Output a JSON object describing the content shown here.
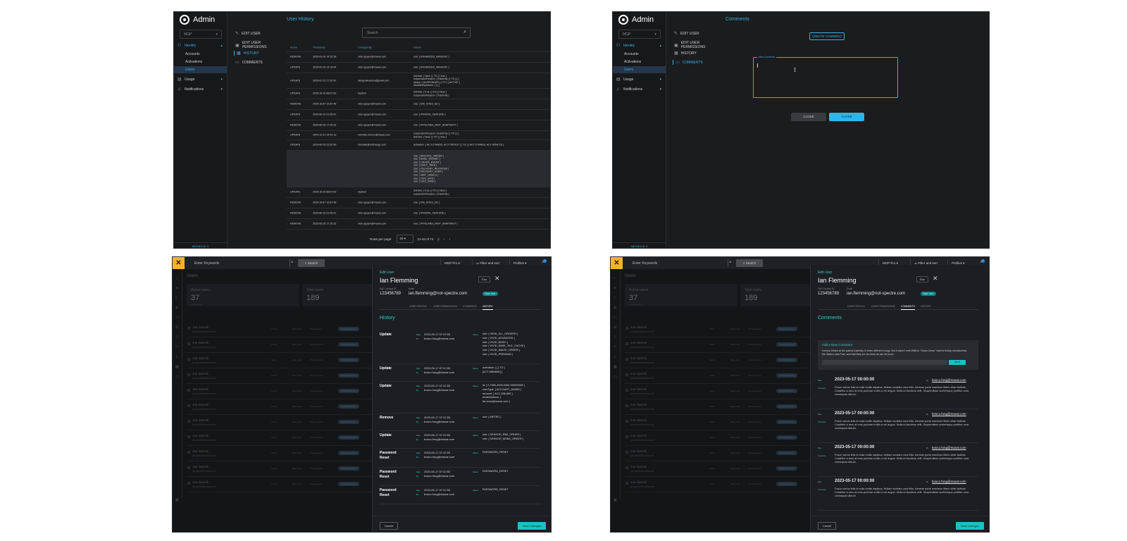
{
  "admin": {
    "brand": "Admin",
    "org_select": "MGP",
    "nav": [
      {
        "label": "Identity",
        "icon": "identity-icon"
      },
      {
        "label": "Usage",
        "icon": "usage-icon"
      },
      {
        "label": "Notifications",
        "icon": "bell-icon"
      }
    ],
    "identity_sub": [
      "Accounts",
      "Activations",
      "Users"
    ],
    "sidebar_footer": "MICHELLE 3",
    "subnav": [
      "Edit User",
      "Edit User Permissions",
      "History",
      "Comments"
    ]
  },
  "history_panel": {
    "title": "User History",
    "search_placeholder": "Search",
    "columns": [
      "Action",
      "Timestamp",
      "Changed By",
      "Values"
    ],
    "rows": [
      {
        "action": "REMOVE",
        "ts": "2026-02-24 14:31:28",
        "by": "nick.nguyen@maxar.com",
        "val": "role: [ ENHANCED_IMAGERY ]"
      },
      {
        "action": "UPDATE",
        "ts": "2026-02-24 14:16:54",
        "by": "nick.nguyen@maxar.com",
        "val": "role: [ ENHANCED_IMAGERY ]"
      },
      {
        "action": "UPDATE",
        "ts": "2026-02-23 17:32:42",
        "by": "skingmatuanbo@gmail.com",
        "val": "isActive: [ false ] [ TO ] [ true ]\nsuspensionReason: [ Inactivity ] [ TO ] [ ]\nstatus: [ SUSPENDED ] [ TO ] [ ACTIVE ]\ndisabledByAdmin: [ ] [ ]"
      },
      {
        "action": "UPDATE",
        "ts": "2025-18-16 88:87:83",
        "by": "System",
        "val": "isActive: [ true ] [ TO ] [ false ]\nsuspensionReason: [ Inactivity ]"
      },
      {
        "action": "REMOVE",
        "ts": "2025-18-87 15:87:48",
        "by": "nick.nguyen@maxar.com",
        "val": "role: [ DM_SITES_ED ]"
      },
      {
        "action": "UPDATE",
        "ts": "2025-89-15 21:59:41",
        "by": "nick.nguyen@maxar.com",
        "val": "role: [ PRIVATE_FEATURE ]"
      },
      {
        "action": "REMOVE",
        "ts": "2025-85-26 17:29:32",
        "by": "nick.nguyen@maxar.com",
        "val": "role: [ PIPELINES_MGP_SNAPSHOT ]"
      },
      {
        "action": "UPDATE",
        "ts": "2024-12-31 14:51:13",
        "by": "michelle.munoz@maxar.com",
        "val": "suspensionReason: [ Inactivity ] [ TO ] [ ]\nisActive: [ false ] [ TO ] [ true ]"
      },
      {
        "action": "UPDATE",
        "ts": "2024-89-26 22:52:89",
        "by": "michelle@michange.com",
        "val": "activation: [ ACT-2794833, ACT-7567817 ] [ TO ] [ ACT-2794833, ACT-9054718 ]"
      },
      {
        "action": "",
        "ts": "",
        "by": "",
        "val": "role: [ ARCHIVE_ORDER ]\nrole: [ BASE_MOSAIC ]\nrole: [ CROSS_EVENT ]\nrole: [ DAILY_TAKE ]\nrole: [ DELIVERY_REGISTER ]\nrole: [ DELIVERY_USER ]\nrole: [ MAP_LABELS ]\nrole: [ OGC_WFS ]\nrole: [ OGC_WMS ]"
      },
      {
        "action": "UPDATE",
        "ts": "2025-18-16 88:87:83",
        "by": "System",
        "val": "isActive: [ true ] [ TO ] [ false ]\nsuspensionReason: [ Inactivity ]"
      },
      {
        "action": "REMOVE",
        "ts": "2025-18-87 15:87:48",
        "by": "nick.nguyen@maxar.com",
        "val": "role: [ DM_SITES_ED ]"
      },
      {
        "action": "REMOVE",
        "ts": "2025-89-15 21:59:41",
        "by": "nick.nguyen@maxar.com",
        "val": "role: [ PRIVATE_FEATURE ]"
      },
      {
        "action": "REMOVE",
        "ts": "2025-85-26 17:29:32",
        "by": "nick.nguyen@maxar.com",
        "val": "role: [ PIPELINES_MGP_SNAPSHOT ]"
      }
    ],
    "pager": {
      "rows_per_page_label": "Rows per page:",
      "rows_per_page": "20",
      "range": "21-40 of 74"
    }
  },
  "comments_panel": {
    "title": "Comments",
    "create_button": "Create Comment",
    "field_label": "New Comment",
    "close_grey": "Close",
    "close_blue": "Close"
  },
  "users_app": {
    "keyword_placeholder": "Enter Keywords",
    "search_button": "Search",
    "product_select": "MGP Pro",
    "filter_sort": "Filter and sort",
    "profiles": "Profiles",
    "page_title": "Users",
    "stats": [
      {
        "label": "Active users",
        "value": "37",
        "sub": "Last 30 days"
      },
      {
        "label": "Total users",
        "value": "189",
        "sub": ""
      }
    ],
    "rows": [
      {
        "name": "Joe Garrick",
        "email": "joe.garrick@maxar.com",
        "status": "Active",
        "role": "Base User",
        "agency": "The Avengers",
        "tag": "Standard Group"
      }
    ],
    "row_count": 11
  },
  "drawer": {
    "title": "Edit User",
    "name": "Ian Flemming",
    "sap_label": "SAP Contract ID",
    "sap_value": "123456789",
    "email_label": "Email",
    "email_value": "ian.flemming@not-spectre.com",
    "role_badge": "Base User",
    "esc": "Esc",
    "tabs": [
      "User Profile",
      "User Permissions",
      "Comments",
      "History"
    ],
    "cancel": "Cancel",
    "save": "Save Changes"
  },
  "history_drawer": {
    "section": "History",
    "entries": [
      {
        "action": "Update",
        "date": "2023-05-17 07:22:53",
        "by": "bosco.fong@maxar.com",
        "values": "role: [ VIEW_ALL_ORDERS ]\nrole: [ VIVID_ADVANCED ]\nrole: [ VIVID_BASIC ]\nrole: [ VIVID_BASE_TILE_CACHE ]\nrole: [ VIVID_IMAGE_ORDER ]\nrole: [ VIVID_PREMIUM ]"
      },
      {
        "action": "Update",
        "date": "2023-05-17 07:22:53",
        "by": "bosco.fong@maxar.com",
        "values": "activation: [ ] [ TO ]\n[ACT-958465K] ]"
      },
      {
        "action": "Update",
        "date": "2023-05-17 07:22:53",
        "by": "bosco.fong@maxar.com",
        "values": "id: [ 2-7980-4925-9382-3053S9DE ]\nuserType: [ ACCOUNT_ADMIN ]\naccount: [ ACC-836-885 ]\nemailAddress: [\nlliz.amur@maxar.com ]"
      },
      {
        "action": "Remove",
        "date": "2023-05-17 07:22:53",
        "by": "bosco.fong@maxar.com",
        "values": "role: [ METRO ]"
      },
      {
        "action": "Update",
        "date": "2023-05-17 07:22:53",
        "by": "bosco.fong@maxar.com",
        "values": "role: [ SENSOR_RBZ_ORDER ]\nrole: [ SENSOR_MOBA_ORDER ]"
      },
      {
        "action": "Password\nReset",
        "date": "2023-05-17 07:22:53",
        "by": "bosco.fong@maxar.com",
        "values": "PASSWORD_RESET"
      },
      {
        "action": "Password\nReset",
        "date": "2023-05-17 07:22:53",
        "by": "bosco.fong@maxar.com",
        "values": "PASSWORD_RESET"
      },
      {
        "action": "Password\nReset",
        "date": "2023-05-17 07:22:53",
        "by": "bosco.fong@maxar.com",
        "values": "PASSWORD_RESET"
      }
    ],
    "keys": {
      "date": "Date",
      "by": "By",
      "values": "Values"
    }
  },
  "comments_drawer": {
    "section": "Comments",
    "add_title": "Add a New Comment",
    "draft": "Lennon hinted at the walrus's identity in three different songs. But it wasn't until 1968 in \"Glass Onion\" that he finally revealed that the Walrus was Paul, and that they are as close as can be [non]",
    "send": "Send",
    "keys": {
      "date": "Date",
      "comment": "Comment",
      "by": "By"
    },
    "entries": [
      {
        "date": "2023-05-17   00:00:00",
        "by": "bosco.fong@maxar.com",
        "body": "Fusce varius felis id nulla mollis dapibus. Nullam sodales urna felis. Aenean porta maximus libero vitae facilisis. Curabitur a arcu at eros pulvinar mollis a vel augue. Nulla id faucibus velit. Suspendisse scelerisque porttitor urna consequat dictum."
      },
      {
        "date": "2023-05-17   00:00:00",
        "by": "bosco.fong@maxar.com",
        "body": "Fusce varius felis id nulla mollis dapibus. Nullam sodales urna felis. Aenean porta maximus libero vitae facilisis. Curabitur a arcu at eros pulvinar mollis a vel augue. Nulla id faucibus velit. Suspendisse scelerisque porttitor urna consequat dictum."
      },
      {
        "date": "2023-05-17   00:00:00",
        "by": "bosco.fong@maxar.com",
        "body": "Fusce varius felis id nulla mollis dapibus. Nullam sodales urna felis. Aenean porta maximus libero vitae facilisis. Curabitur a arcu at eros pulvinar mollis a vel augue. Nulla id faucibus velit. Suspendisse scelerisque porttitor urna consequat dictum."
      },
      {
        "date": "2023-05-17   00:00:00",
        "by": "bosco.fong@maxar.com",
        "body": "Fusce varius felis id nulla mollis dapibus. Nullam sodales urna felis. Aenean porta maximus libero vitae facilisis. Curabitur a arcu at eros pulvinar mollis a vel augue. Nulla id faucibus velit. Suspendisse scelerisque porttitor urna consequat dictum."
      }
    ]
  },
  "colors": {
    "accent_blue": "#3aaee0",
    "accent_teal": "#1cc0c7",
    "brand_yellow": "#f2b52a",
    "background": "#1b1c1e"
  }
}
